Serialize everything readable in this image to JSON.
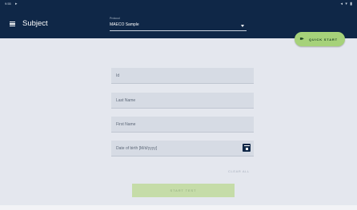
{
  "status_bar": {
    "time": "9:55",
    "notification_icon": "play-icon",
    "system_icons": "◂ ▾ ▮"
  },
  "app_bar": {
    "menu_icon": "hamburger-menu-icon",
    "title": "Subject",
    "protocol": {
      "label": "Protocol",
      "value": "MAECO Sample",
      "icon": "dropdown-arrow-icon"
    }
  },
  "quick_start": {
    "icon": "fast-forward-icon",
    "label": "QUICK START"
  },
  "form": {
    "id_placeholder": "Id",
    "last_name_placeholder": "Last Name",
    "first_name_placeholder": "First Name",
    "dob_placeholder": "Date of birth  [M/d/yyyy]",
    "dob_icon": "calendar-icon",
    "clear_all_label": "CLEAR ALL",
    "start_test_label": "START TEST"
  },
  "colors": {
    "app_bar": "#0f2747",
    "background": "#e4e7ee",
    "field_fill": "#d6dbe4",
    "accent_green": "#a6d27a",
    "disabled_green": "#c5dca8"
  }
}
